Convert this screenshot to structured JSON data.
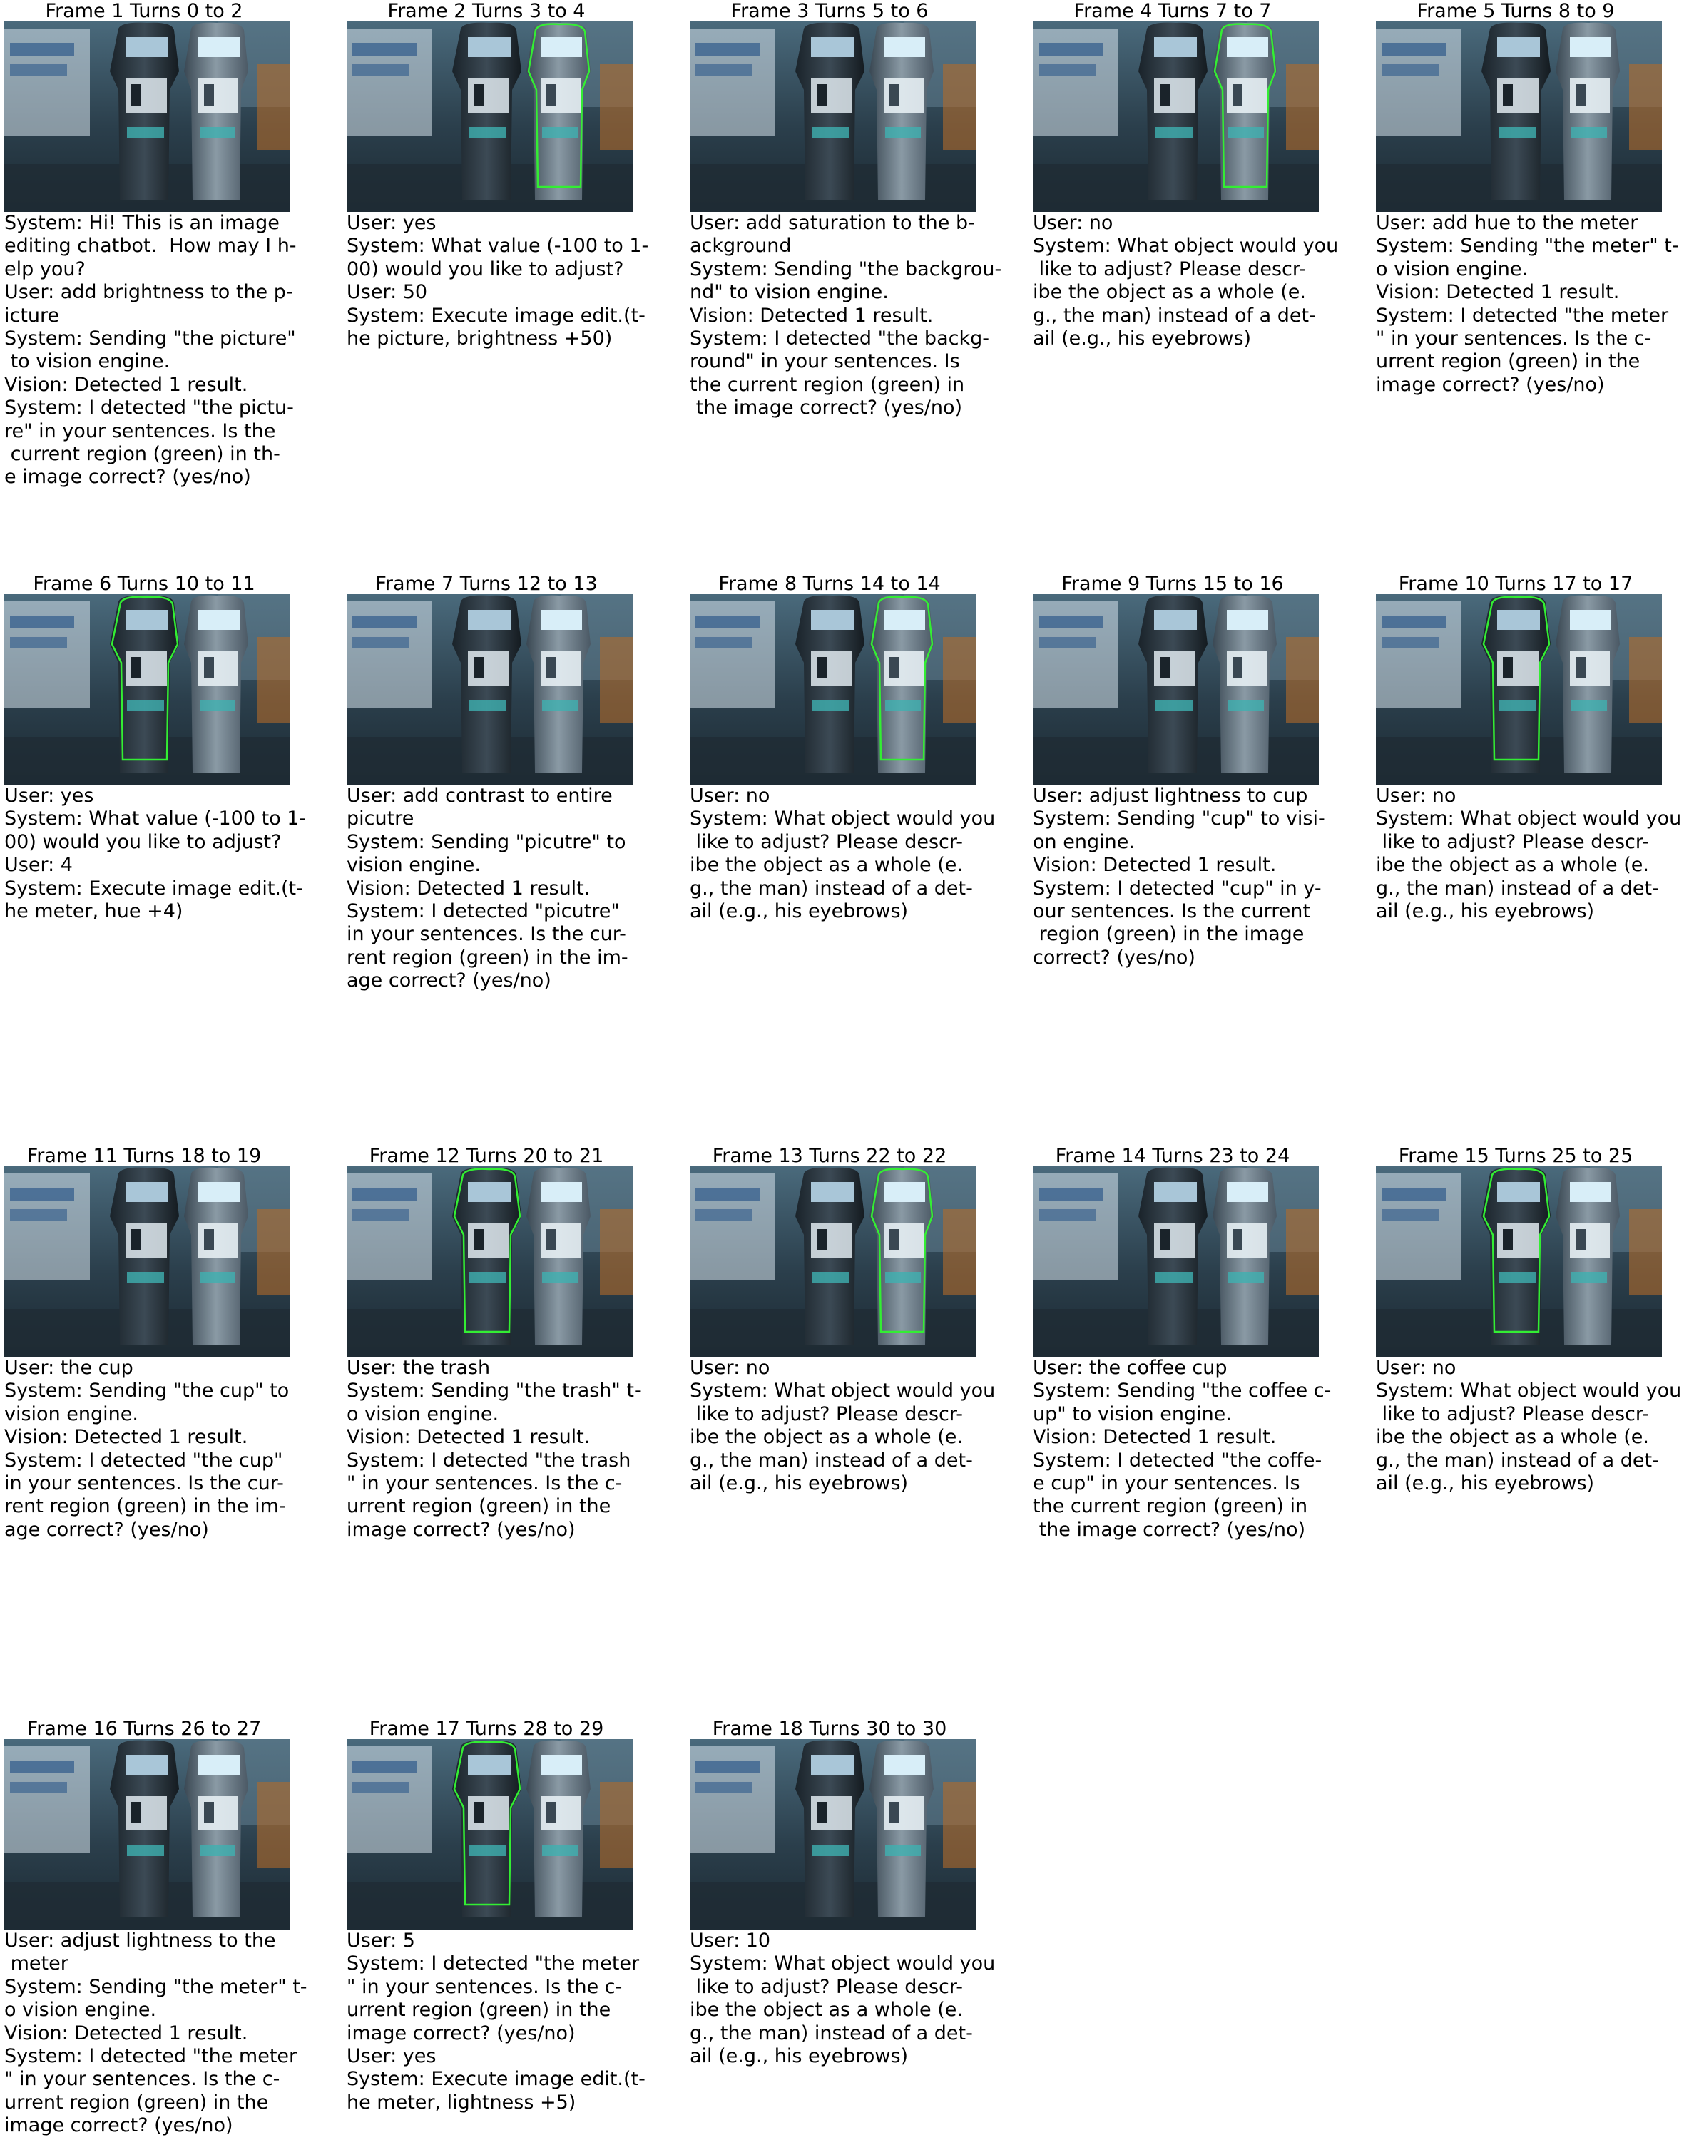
{
  "colors": {
    "highlight": "#33ee33",
    "background_text": "#000000"
  },
  "frames": [
    {
      "title": "Frame 1 Turns 0 to 2",
      "highlight": "none",
      "text": "System: Hi! This is an image\nediting chatbot.  How may I h-\nelp you?\nUser: add brightness to the p-\nicture\nSystem: Sending \"the picture\"\n to vision engine.\nVision: Detected 1 result.\nSystem: I detected \"the pictu-\nre\" in your sentences. Is the\n current region (green) in th-\ne image correct? (yes/no)"
    },
    {
      "title": "Frame 2 Turns 3 to 4",
      "highlight": "right",
      "text": "User: yes\nSystem: What value (-100 to 1-\n00) would you like to adjust?\nUser: 50\nSystem: Execute image edit.(t-\nhe picture, brightness +50)"
    },
    {
      "title": "Frame 3 Turns 5 to 6",
      "highlight": "none",
      "text": "User: add saturation to the b-\nackground\nSystem: Sending \"the backgrou-\nnd\" to vision engine.\nVision: Detected 1 result.\nSystem: I detected \"the backg-\nround\" in your sentences. Is\nthe current region (green) in\n the image correct? (yes/no)"
    },
    {
      "title": "Frame 4 Turns 7 to 7",
      "highlight": "right",
      "text": "User: no\nSystem: What object would you\n like to adjust? Please descr-\nibe the object as a whole (e.\ng., the man) instead of a det-\nail (e.g., his eyebrows)"
    },
    {
      "title": "Frame 5 Turns 8 to 9",
      "highlight": "none",
      "text": "User: add hue to the meter\nSystem: Sending \"the meter\" t-\no vision engine.\nVision: Detected 1 result.\nSystem: I detected \"the meter\n\" in your sentences. Is the c-\nurrent region (green) in the\nimage correct? (yes/no)"
    },
    {
      "title": "Frame 6 Turns 10 to 11",
      "highlight": "left",
      "text": "User: yes\nSystem: What value (-100 to 1-\n00) would you like to adjust?\nUser: 4\nSystem: Execute image edit.(t-\nhe meter, hue +4)"
    },
    {
      "title": "Frame 7 Turns 12 to 13",
      "highlight": "none",
      "text": "User: add contrast to entire\npicutre\nSystem: Sending \"picutre\" to\nvision engine.\nVision: Detected 1 result.\nSystem: I detected \"picutre\"\nin your sentences. Is the cur-\nrent region (green) in the im-\nage correct? (yes/no)"
    },
    {
      "title": "Frame 8 Turns 14 to 14",
      "highlight": "right",
      "text": "User: no\nSystem: What object would you\n like to adjust? Please descr-\nibe the object as a whole (e.\ng., the man) instead of a det-\nail (e.g., his eyebrows)"
    },
    {
      "title": "Frame 9 Turns 15 to 16",
      "highlight": "none",
      "text": "User: adjust lightness to cup\nSystem: Sending \"cup\" to visi-\non engine.\nVision: Detected 1 result.\nSystem: I detected \"cup\" in y-\nour sentences. Is the current\n region (green) in the image\ncorrect? (yes/no)"
    },
    {
      "title": "Frame 10 Turns 17 to 17",
      "highlight": "left",
      "text": "User: no\nSystem: What object would you\n like to adjust? Please descr-\nibe the object as a whole (e.\ng., the man) instead of a det-\nail (e.g., his eyebrows)"
    },
    {
      "title": "Frame 11 Turns 18 to 19",
      "highlight": "none",
      "text": "User: the cup\nSystem: Sending \"the cup\" to\nvision engine.\nVision: Detected 1 result.\nSystem: I detected \"the cup\"\nin your sentences. Is the cur-\nrent region (green) in the im-\nage correct? (yes/no)"
    },
    {
      "title": "Frame 12 Turns 20 to 21",
      "highlight": "left",
      "text": "User: the trash\nSystem: Sending \"the trash\" t-\no vision engine.\nVision: Detected 1 result.\nSystem: I detected \"the trash\n\" in your sentences. Is the c-\nurrent region (green) in the\nimage correct? (yes/no)"
    },
    {
      "title": "Frame 13 Turns 22 to 22",
      "highlight": "right",
      "text": "User: no\nSystem: What object would you\n like to adjust? Please descr-\nibe the object as a whole (e.\ng., the man) instead of a det-\nail (e.g., his eyebrows)"
    },
    {
      "title": "Frame 14 Turns 23 to 24",
      "highlight": "none",
      "text": "User: the coffee cup\nSystem: Sending \"the coffee c-\nup\" to vision engine.\nVision: Detected 1 result.\nSystem: I detected \"the coffe-\ne cup\" in your sentences. Is\nthe current region (green) in\n the image correct? (yes/no)"
    },
    {
      "title": "Frame 15 Turns 25 to 25",
      "highlight": "left",
      "text": "User: no\nSystem: What object would you\n like to adjust? Please descr-\nibe the object as a whole (e.\ng., the man) instead of a det-\nail (e.g., his eyebrows)"
    },
    {
      "title": "Frame 16 Turns 26 to 27",
      "highlight": "none",
      "text": "User: adjust lightness to the\n meter\nSystem: Sending \"the meter\" t-\no vision engine.\nVision: Detected 1 result.\nSystem: I detected \"the meter\n\" in your sentences. Is the c-\nurrent region (green) in the\nimage correct? (yes/no)"
    },
    {
      "title": "Frame 17 Turns 28 to 29",
      "highlight": "left",
      "text": "User: 5\nSystem: I detected \"the meter\n\" in your sentences. Is the c-\nurrent region (green) in the\nimage correct? (yes/no)\nUser: yes\nSystem: Execute image edit.(t-\nhe meter, lightness +5)"
    },
    {
      "title": "Frame 18 Turns 30 to 30",
      "highlight": "none",
      "text": "User: 10\nSystem: What object would you\n like to adjust? Please descr-\nibe the object as a whole (e.\ng., the man) instead of a det-\nail (e.g., his eyebrows)"
    }
  ]
}
